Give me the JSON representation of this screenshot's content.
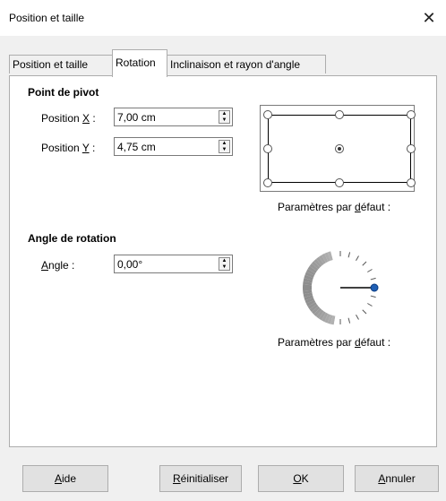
{
  "window": {
    "title": "Position et taille",
    "close_glyph": "✕"
  },
  "tabs": [
    {
      "label": "Position et taille",
      "active": false
    },
    {
      "label": "Rotation",
      "active": true
    },
    {
      "label": "Inclinaison et rayon d'angle",
      "active": false
    }
  ],
  "pivot": {
    "section_title": "Point de pivot",
    "pos_x": {
      "label_prefix": "Position ",
      "label_key": "X",
      "label_suffix": " :",
      "value": "7,00 cm"
    },
    "pos_y": {
      "label_prefix": "Position ",
      "label_key": "Y",
      "label_suffix": " :",
      "value": "4,75 cm"
    },
    "defaults": {
      "prefix": "Paramètres par ",
      "key": "d",
      "suffix": "éfaut :"
    }
  },
  "rotation": {
    "section_title": "Angle de rotation",
    "angle": {
      "label_key": "A",
      "label_rest": "ngle :",
      "value": "0,00°"
    },
    "defaults": {
      "prefix": "Paramètres par ",
      "key": "d",
      "suffix": "éfaut :"
    },
    "angle_degrees": 0,
    "accent_color": "#1f5fb4"
  },
  "buttons": {
    "help": {
      "key": "A",
      "rest": "ide"
    },
    "reset": {
      "key": "R",
      "rest": "éinitialiser"
    },
    "ok": {
      "key": "O",
      "rest": "K"
    },
    "cancel": {
      "key": "A",
      "rest": "nnuler"
    }
  },
  "icons": {
    "close": "close-icon",
    "spin_up": "chevron-up-icon",
    "spin_down": "chevron-down-icon"
  }
}
